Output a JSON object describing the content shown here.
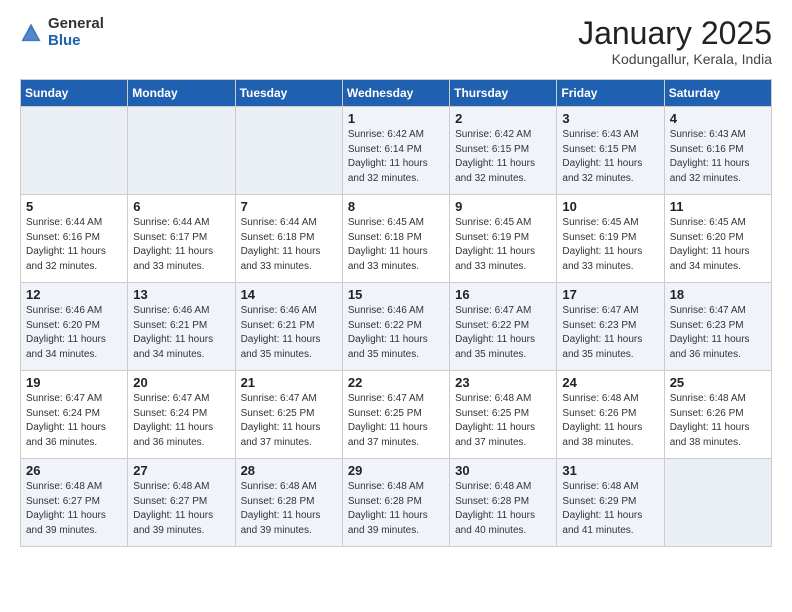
{
  "logo": {
    "general": "General",
    "blue": "Blue"
  },
  "header": {
    "title": "January 2025",
    "subtitle": "Kodungallur, Kerala, India"
  },
  "weekdays": [
    "Sunday",
    "Monday",
    "Tuesday",
    "Wednesday",
    "Thursday",
    "Friday",
    "Saturday"
  ],
  "weeks": [
    [
      {
        "day": "",
        "info": ""
      },
      {
        "day": "",
        "info": ""
      },
      {
        "day": "",
        "info": ""
      },
      {
        "day": "1",
        "info": "Sunrise: 6:42 AM\nSunset: 6:14 PM\nDaylight: 11 hours\nand 32 minutes."
      },
      {
        "day": "2",
        "info": "Sunrise: 6:42 AM\nSunset: 6:15 PM\nDaylight: 11 hours\nand 32 minutes."
      },
      {
        "day": "3",
        "info": "Sunrise: 6:43 AM\nSunset: 6:15 PM\nDaylight: 11 hours\nand 32 minutes."
      },
      {
        "day": "4",
        "info": "Sunrise: 6:43 AM\nSunset: 6:16 PM\nDaylight: 11 hours\nand 32 minutes."
      }
    ],
    [
      {
        "day": "5",
        "info": "Sunrise: 6:44 AM\nSunset: 6:16 PM\nDaylight: 11 hours\nand 32 minutes."
      },
      {
        "day": "6",
        "info": "Sunrise: 6:44 AM\nSunset: 6:17 PM\nDaylight: 11 hours\nand 33 minutes."
      },
      {
        "day": "7",
        "info": "Sunrise: 6:44 AM\nSunset: 6:18 PM\nDaylight: 11 hours\nand 33 minutes."
      },
      {
        "day": "8",
        "info": "Sunrise: 6:45 AM\nSunset: 6:18 PM\nDaylight: 11 hours\nand 33 minutes."
      },
      {
        "day": "9",
        "info": "Sunrise: 6:45 AM\nSunset: 6:19 PM\nDaylight: 11 hours\nand 33 minutes."
      },
      {
        "day": "10",
        "info": "Sunrise: 6:45 AM\nSunset: 6:19 PM\nDaylight: 11 hours\nand 33 minutes."
      },
      {
        "day": "11",
        "info": "Sunrise: 6:45 AM\nSunset: 6:20 PM\nDaylight: 11 hours\nand 34 minutes."
      }
    ],
    [
      {
        "day": "12",
        "info": "Sunrise: 6:46 AM\nSunset: 6:20 PM\nDaylight: 11 hours\nand 34 minutes."
      },
      {
        "day": "13",
        "info": "Sunrise: 6:46 AM\nSunset: 6:21 PM\nDaylight: 11 hours\nand 34 minutes."
      },
      {
        "day": "14",
        "info": "Sunrise: 6:46 AM\nSunset: 6:21 PM\nDaylight: 11 hours\nand 35 minutes."
      },
      {
        "day": "15",
        "info": "Sunrise: 6:46 AM\nSunset: 6:22 PM\nDaylight: 11 hours\nand 35 minutes."
      },
      {
        "day": "16",
        "info": "Sunrise: 6:47 AM\nSunset: 6:22 PM\nDaylight: 11 hours\nand 35 minutes."
      },
      {
        "day": "17",
        "info": "Sunrise: 6:47 AM\nSunset: 6:23 PM\nDaylight: 11 hours\nand 35 minutes."
      },
      {
        "day": "18",
        "info": "Sunrise: 6:47 AM\nSunset: 6:23 PM\nDaylight: 11 hours\nand 36 minutes."
      }
    ],
    [
      {
        "day": "19",
        "info": "Sunrise: 6:47 AM\nSunset: 6:24 PM\nDaylight: 11 hours\nand 36 minutes."
      },
      {
        "day": "20",
        "info": "Sunrise: 6:47 AM\nSunset: 6:24 PM\nDaylight: 11 hours\nand 36 minutes."
      },
      {
        "day": "21",
        "info": "Sunrise: 6:47 AM\nSunset: 6:25 PM\nDaylight: 11 hours\nand 37 minutes."
      },
      {
        "day": "22",
        "info": "Sunrise: 6:47 AM\nSunset: 6:25 PM\nDaylight: 11 hours\nand 37 minutes."
      },
      {
        "day": "23",
        "info": "Sunrise: 6:48 AM\nSunset: 6:25 PM\nDaylight: 11 hours\nand 37 minutes."
      },
      {
        "day": "24",
        "info": "Sunrise: 6:48 AM\nSunset: 6:26 PM\nDaylight: 11 hours\nand 38 minutes."
      },
      {
        "day": "25",
        "info": "Sunrise: 6:48 AM\nSunset: 6:26 PM\nDaylight: 11 hours\nand 38 minutes."
      }
    ],
    [
      {
        "day": "26",
        "info": "Sunrise: 6:48 AM\nSunset: 6:27 PM\nDaylight: 11 hours\nand 39 minutes."
      },
      {
        "day": "27",
        "info": "Sunrise: 6:48 AM\nSunset: 6:27 PM\nDaylight: 11 hours\nand 39 minutes."
      },
      {
        "day": "28",
        "info": "Sunrise: 6:48 AM\nSunset: 6:28 PM\nDaylight: 11 hours\nand 39 minutes."
      },
      {
        "day": "29",
        "info": "Sunrise: 6:48 AM\nSunset: 6:28 PM\nDaylight: 11 hours\nand 39 minutes."
      },
      {
        "day": "30",
        "info": "Sunrise: 6:48 AM\nSunset: 6:28 PM\nDaylight: 11 hours\nand 40 minutes."
      },
      {
        "day": "31",
        "info": "Sunrise: 6:48 AM\nSunset: 6:29 PM\nDaylight: 11 hours\nand 41 minutes."
      },
      {
        "day": "",
        "info": ""
      }
    ]
  ]
}
